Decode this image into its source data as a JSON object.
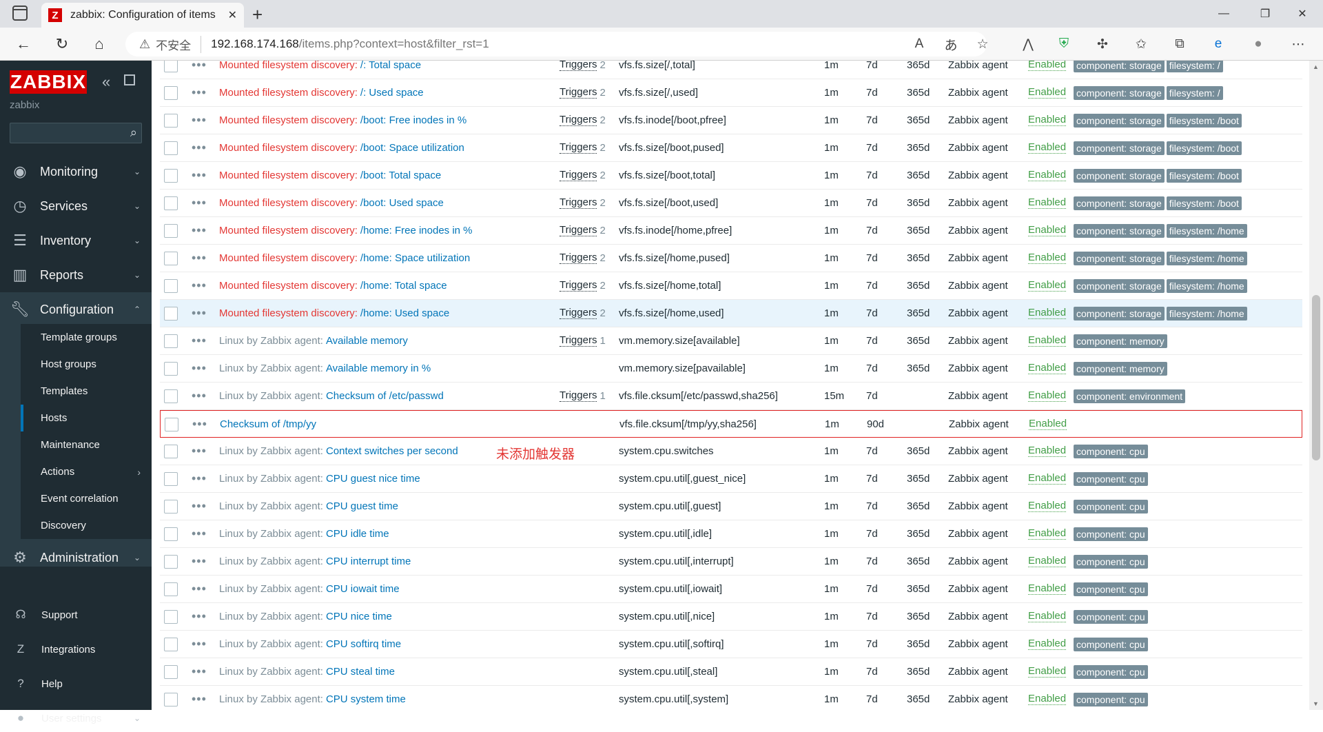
{
  "browser": {
    "tab_title": "zabbix: Configuration of items",
    "favicon": "Z",
    "insecure_label": "不安全",
    "url_host": "192.168.174.168",
    "url_path": "/items.php?context=host&filter_rst=1"
  },
  "sidebar": {
    "logo": "ZABBIX",
    "server_name": "zabbix",
    "menu": [
      {
        "label": "Monitoring"
      },
      {
        "label": "Services"
      },
      {
        "label": "Inventory"
      },
      {
        "label": "Reports"
      },
      {
        "label": "Configuration"
      },
      {
        "label": "Administration"
      }
    ],
    "submenu": [
      {
        "label": "Template groups"
      },
      {
        "label": "Host groups"
      },
      {
        "label": "Templates"
      },
      {
        "label": "Hosts"
      },
      {
        "label": "Maintenance"
      },
      {
        "label": "Actions"
      },
      {
        "label": "Event correlation"
      },
      {
        "label": "Discovery"
      }
    ],
    "footer": [
      {
        "label": "Support"
      },
      {
        "label": "Integrations"
      },
      {
        "label": "Help"
      },
      {
        "label": "User settings"
      }
    ]
  },
  "annotation": "未添加触发器",
  "colors": {
    "accent_red": "#d40000",
    "sidebar_bg": "#1f2c33",
    "link_blue": "#0275b8",
    "enabled_green": "#429e47",
    "tag_grey": "#768d99"
  },
  "rows": [
    {
      "prefix": "Mounted filesystem discovery:",
      "prefix_color": "red",
      "name": "/: Total space",
      "triggers": "Triggers",
      "trigger_count": "2",
      "key": "vfs.fs.size[/,total]",
      "interval": "1m",
      "history": "7d",
      "trends": "365d",
      "type": "Zabbix agent",
      "status": "Enabled",
      "tags": [
        "component: storage",
        "filesystem: /"
      ]
    },
    {
      "prefix": "Mounted filesystem discovery:",
      "prefix_color": "red",
      "name": "/: Used space",
      "triggers": "Triggers",
      "trigger_count": "2",
      "key": "vfs.fs.size[/,used]",
      "interval": "1m",
      "history": "7d",
      "trends": "365d",
      "type": "Zabbix agent",
      "status": "Enabled",
      "tags": [
        "component: storage",
        "filesystem: /"
      ]
    },
    {
      "prefix": "Mounted filesystem discovery:",
      "prefix_color": "red",
      "name": "/boot: Free inodes in %",
      "triggers": "Triggers",
      "trigger_count": "2",
      "key": "vfs.fs.inode[/boot,pfree]",
      "interval": "1m",
      "history": "7d",
      "trends": "365d",
      "type": "Zabbix agent",
      "status": "Enabled",
      "tags": [
        "component: storage",
        "filesystem: /boot"
      ]
    },
    {
      "prefix": "Mounted filesystem discovery:",
      "prefix_color": "red",
      "name": "/boot: Space utilization",
      "triggers": "Triggers",
      "trigger_count": "2",
      "key": "vfs.fs.size[/boot,pused]",
      "interval": "1m",
      "history": "7d",
      "trends": "365d",
      "type": "Zabbix agent",
      "status": "Enabled",
      "tags": [
        "component: storage",
        "filesystem: /boot"
      ]
    },
    {
      "prefix": "Mounted filesystem discovery:",
      "prefix_color": "red",
      "name": "/boot: Total space",
      "triggers": "Triggers",
      "trigger_count": "2",
      "key": "vfs.fs.size[/boot,total]",
      "interval": "1m",
      "history": "7d",
      "trends": "365d",
      "type": "Zabbix agent",
      "status": "Enabled",
      "tags": [
        "component: storage",
        "filesystem: /boot"
      ]
    },
    {
      "prefix": "Mounted filesystem discovery:",
      "prefix_color": "red",
      "name": "/boot: Used space",
      "triggers": "Triggers",
      "trigger_count": "2",
      "key": "vfs.fs.size[/boot,used]",
      "interval": "1m",
      "history": "7d",
      "trends": "365d",
      "type": "Zabbix agent",
      "status": "Enabled",
      "tags": [
        "component: storage",
        "filesystem: /boot"
      ]
    },
    {
      "prefix": "Mounted filesystem discovery:",
      "prefix_color": "red",
      "name": "/home: Free inodes in %",
      "triggers": "Triggers",
      "trigger_count": "2",
      "key": "vfs.fs.inode[/home,pfree]",
      "interval": "1m",
      "history": "7d",
      "trends": "365d",
      "type": "Zabbix agent",
      "status": "Enabled",
      "tags": [
        "component: storage",
        "filesystem: /home"
      ]
    },
    {
      "prefix": "Mounted filesystem discovery:",
      "prefix_color": "red",
      "name": "/home: Space utilization",
      "triggers": "Triggers",
      "trigger_count": "2",
      "key": "vfs.fs.size[/home,pused]",
      "interval": "1m",
      "history": "7d",
      "trends": "365d",
      "type": "Zabbix agent",
      "status": "Enabled",
      "tags": [
        "component: storage",
        "filesystem: /home"
      ]
    },
    {
      "prefix": "Mounted filesystem discovery:",
      "prefix_color": "red",
      "name": "/home: Total space",
      "triggers": "Triggers",
      "trigger_count": "2",
      "key": "vfs.fs.size[/home,total]",
      "interval": "1m",
      "history": "7d",
      "trends": "365d",
      "type": "Zabbix agent",
      "status": "Enabled",
      "tags": [
        "component: storage",
        "filesystem: /home"
      ]
    },
    {
      "prefix": "Mounted filesystem discovery:",
      "prefix_color": "red",
      "name": "/home: Used space",
      "triggers": "Triggers",
      "trigger_count": "2",
      "key": "vfs.fs.size[/home,used]",
      "interval": "1m",
      "history": "7d",
      "trends": "365d",
      "type": "Zabbix agent",
      "status": "Enabled",
      "tags": [
        "component: storage",
        "filesystem: /home"
      ]
    },
    {
      "prefix": "Linux by Zabbix agent:",
      "prefix_color": "grey",
      "name": "Available memory",
      "triggers": "Triggers",
      "trigger_count": "1",
      "key": "vm.memory.size[available]",
      "interval": "1m",
      "history": "7d",
      "trends": "365d",
      "type": "Zabbix agent",
      "status": "Enabled",
      "tags": [
        "component: memory"
      ]
    },
    {
      "prefix": "Linux by Zabbix agent:",
      "prefix_color": "grey",
      "name": "Available memory in %",
      "triggers": "",
      "trigger_count": "",
      "key": "vm.memory.size[pavailable]",
      "interval": "1m",
      "history": "7d",
      "trends": "365d",
      "type": "Zabbix agent",
      "status": "Enabled",
      "tags": [
        "component: memory"
      ]
    },
    {
      "prefix": "Linux by Zabbix agent:",
      "prefix_color": "grey",
      "name": "Checksum of /etc/passwd",
      "triggers": "Triggers",
      "trigger_count": "1",
      "key": "vfs.file.cksum[/etc/passwd,sha256]",
      "interval": "15m",
      "history": "7d",
      "trends": "",
      "type": "Zabbix agent",
      "status": "Enabled",
      "tags": [
        "component: environment"
      ]
    },
    {
      "prefix": "",
      "prefix_color": "grey",
      "name": "Checksum of /tmp/yy",
      "triggers": "",
      "trigger_count": "",
      "key": "vfs.file.cksum[/tmp/yy,sha256]",
      "interval": "1m",
      "history": "90d",
      "trends": "",
      "type": "Zabbix agent",
      "status": "Enabled",
      "tags": []
    },
    {
      "prefix": "Linux by Zabbix agent:",
      "prefix_color": "grey",
      "name": "Context switches per second",
      "triggers": "",
      "trigger_count": "",
      "key": "system.cpu.switches",
      "interval": "1m",
      "history": "7d",
      "trends": "365d",
      "type": "Zabbix agent",
      "status": "Enabled",
      "tags": [
        "component: cpu"
      ]
    },
    {
      "prefix": "Linux by Zabbix agent:",
      "prefix_color": "grey",
      "name": "CPU guest nice time",
      "triggers": "",
      "trigger_count": "",
      "key": "system.cpu.util[,guest_nice]",
      "interval": "1m",
      "history": "7d",
      "trends": "365d",
      "type": "Zabbix agent",
      "status": "Enabled",
      "tags": [
        "component: cpu"
      ]
    },
    {
      "prefix": "Linux by Zabbix agent:",
      "prefix_color": "grey",
      "name": "CPU guest time",
      "triggers": "",
      "trigger_count": "",
      "key": "system.cpu.util[,guest]",
      "interval": "1m",
      "history": "7d",
      "trends": "365d",
      "type": "Zabbix agent",
      "status": "Enabled",
      "tags": [
        "component: cpu"
      ]
    },
    {
      "prefix": "Linux by Zabbix agent:",
      "prefix_color": "grey",
      "name": "CPU idle time",
      "triggers": "",
      "trigger_count": "",
      "key": "system.cpu.util[,idle]",
      "interval": "1m",
      "history": "7d",
      "trends": "365d",
      "type": "Zabbix agent",
      "status": "Enabled",
      "tags": [
        "component: cpu"
      ]
    },
    {
      "prefix": "Linux by Zabbix agent:",
      "prefix_color": "grey",
      "name": "CPU interrupt time",
      "triggers": "",
      "trigger_count": "",
      "key": "system.cpu.util[,interrupt]",
      "interval": "1m",
      "history": "7d",
      "trends": "365d",
      "type": "Zabbix agent",
      "status": "Enabled",
      "tags": [
        "component: cpu"
      ]
    },
    {
      "prefix": "Linux by Zabbix agent:",
      "prefix_color": "grey",
      "name": "CPU iowait time",
      "triggers": "",
      "trigger_count": "",
      "key": "system.cpu.util[,iowait]",
      "interval": "1m",
      "history": "7d",
      "trends": "365d",
      "type": "Zabbix agent",
      "status": "Enabled",
      "tags": [
        "component: cpu"
      ]
    },
    {
      "prefix": "Linux by Zabbix agent:",
      "prefix_color": "grey",
      "name": "CPU nice time",
      "triggers": "",
      "trigger_count": "",
      "key": "system.cpu.util[,nice]",
      "interval": "1m",
      "history": "7d",
      "trends": "365d",
      "type": "Zabbix agent",
      "status": "Enabled",
      "tags": [
        "component: cpu"
      ]
    },
    {
      "prefix": "Linux by Zabbix agent:",
      "prefix_color": "grey",
      "name": "CPU softirq time",
      "triggers": "",
      "trigger_count": "",
      "key": "system.cpu.util[,softirq]",
      "interval": "1m",
      "history": "7d",
      "trends": "365d",
      "type": "Zabbix agent",
      "status": "Enabled",
      "tags": [
        "component: cpu"
      ]
    },
    {
      "prefix": "Linux by Zabbix agent:",
      "prefix_color": "grey",
      "name": "CPU steal time",
      "triggers": "",
      "trigger_count": "",
      "key": "system.cpu.util[,steal]",
      "interval": "1m",
      "history": "7d",
      "trends": "365d",
      "type": "Zabbix agent",
      "status": "Enabled",
      "tags": [
        "component: cpu"
      ]
    },
    {
      "prefix": "Linux by Zabbix agent:",
      "prefix_color": "grey",
      "name": "CPU system time",
      "triggers": "",
      "trigger_count": "",
      "key": "system.cpu.util[,system]",
      "interval": "1m",
      "history": "7d",
      "trends": "365d",
      "type": "Zabbix agent",
      "status": "Enabled",
      "tags": [
        "component: cpu"
      ]
    }
  ]
}
